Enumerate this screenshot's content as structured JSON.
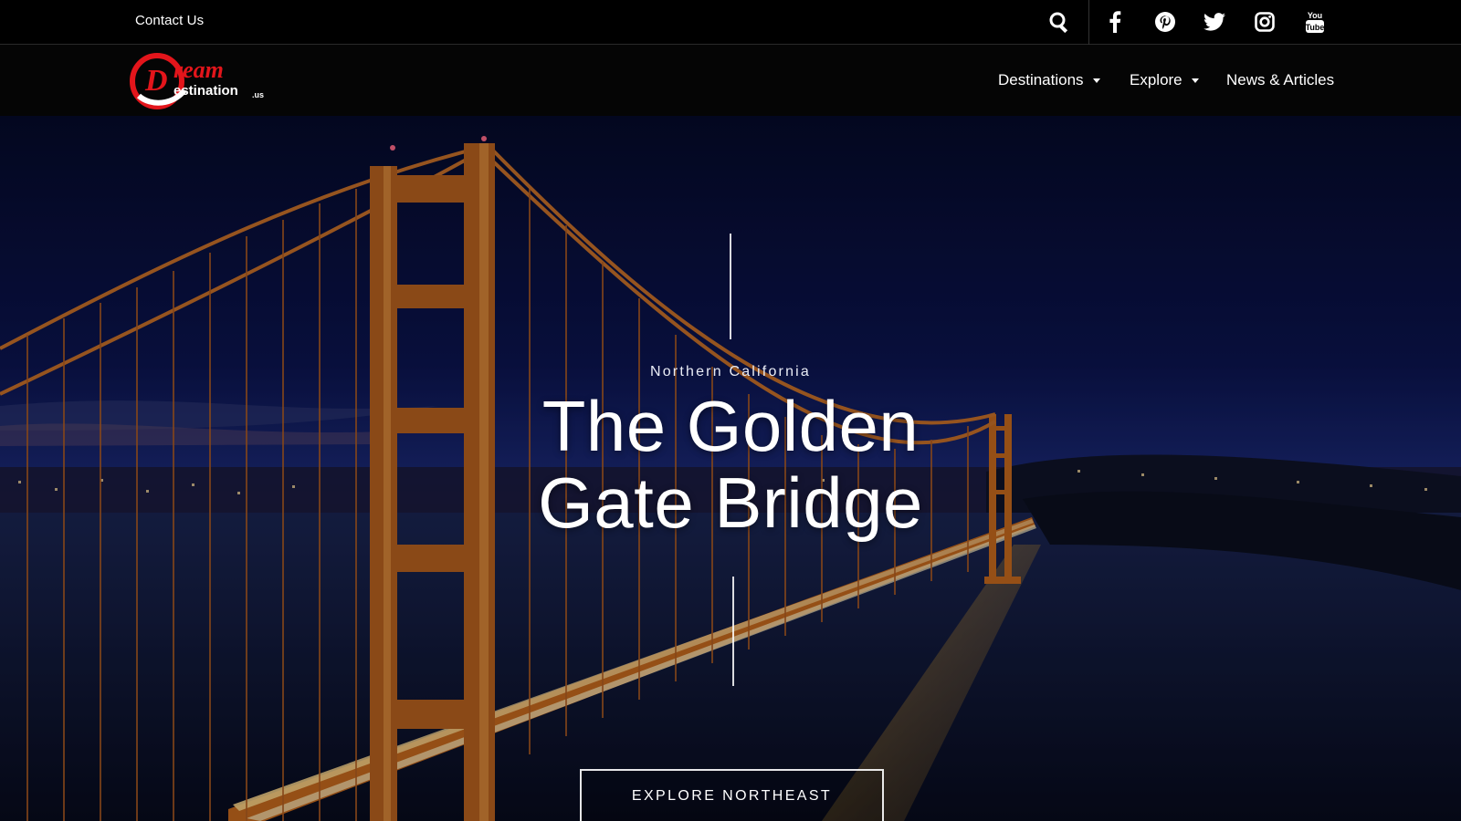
{
  "topbar": {
    "contact_label": "Contact Us",
    "icons": [
      "search-icon",
      "facebook-icon",
      "pinterest-icon",
      "twitter-icon",
      "instagram-icon",
      "youtube-icon"
    ],
    "youtube_text": [
      "You",
      "Tube"
    ]
  },
  "logo": {
    "word1": "ream",
    "word2": "estination",
    "suffix": ".us",
    "letter": "D"
  },
  "nav": {
    "items": [
      {
        "label": "Destinations",
        "has_dropdown": true
      },
      {
        "label": "Explore",
        "has_dropdown": true
      },
      {
        "label": "News & Articles",
        "has_dropdown": false
      }
    ]
  },
  "hero": {
    "subtitle": "Northern California",
    "title": "The Golden Gate Bridge",
    "cta_label": "EXPLORE NORTHEAST"
  },
  "colors": {
    "logo_red": "#e3151b",
    "bridge_orange": "#c76a1e",
    "sky_top": "#050a2a",
    "sky_mid": "#1b2a78"
  }
}
